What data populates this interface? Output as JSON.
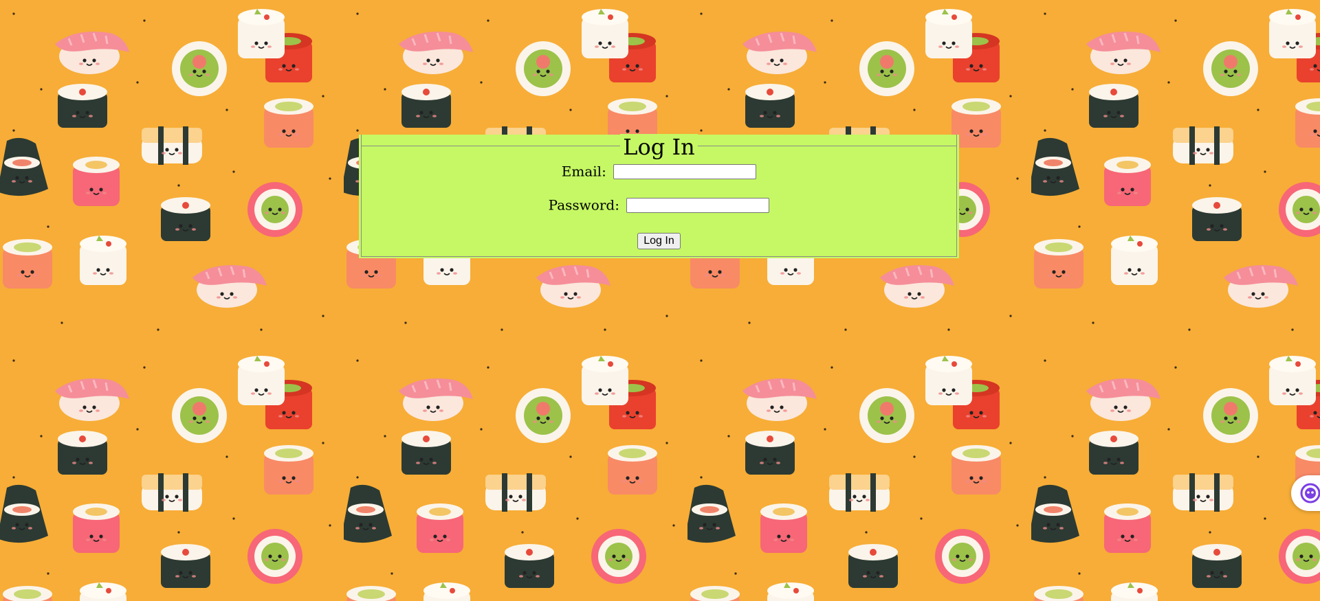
{
  "background": {
    "pattern": "cartoon-sushi-pattern",
    "base_color": "#f7ad37"
  },
  "login_form": {
    "legend": "Log In",
    "panel_color": "#c5f864",
    "email_label": "Email:",
    "email_value": "",
    "password_label": "Password:",
    "password_value": "",
    "submit_label": "Log In"
  },
  "assistant_widget": {
    "icon": "chat-assistant-icon",
    "accent": "#7b3fe4"
  }
}
